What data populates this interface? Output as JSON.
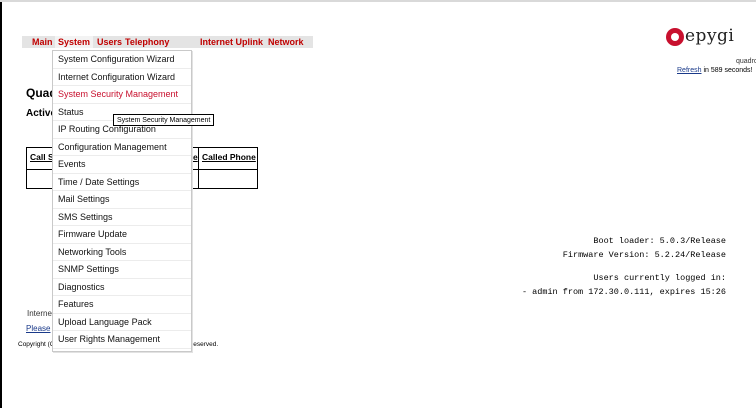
{
  "nav": {
    "items": [
      "Main",
      "System",
      "Users",
      "Telephony",
      "Internet Uplink",
      "Network"
    ],
    "active": "System"
  },
  "logo": {
    "text": "epygi",
    "sub": "quadro"
  },
  "refresh": {
    "link": "Refresh",
    "text": "in 589 seconds!"
  },
  "page": {
    "title": "Quad",
    "active_title": "Active",
    "table_headers": [
      "Call St",
      "e",
      "Called Phone"
    ],
    "internet": "Interne",
    "please": "Please",
    "copyright": "Copyright (C)",
    "rights": "s reserved."
  },
  "menu": {
    "items": [
      "System Configuration Wizard",
      "Internet Configuration Wizard",
      "System Security Management",
      "Status",
      "IP Routing Configuration",
      "Configuration Management",
      "Events",
      "Time / Date Settings",
      "Mail Settings",
      "SMS Settings",
      "Firmware Update",
      "Networking Tools",
      "SNMP Settings",
      "Diagnostics",
      "Features",
      "Upload Language Pack",
      "User Rights Management"
    ],
    "selected": "System Security Management"
  },
  "tooltip": "System Security Management",
  "info": {
    "boot_loader": "Boot loader: 5.0.3/Release",
    "firmware": "Firmware Version: 5.2.24/Release",
    "users_logged": "Users currently logged in:",
    "session": "- admin from 172.30.0.111, expires 15:26"
  },
  "colors": {
    "nav_text": "#c00000",
    "brand": "#c8102e",
    "link": "#1a3a8a"
  }
}
